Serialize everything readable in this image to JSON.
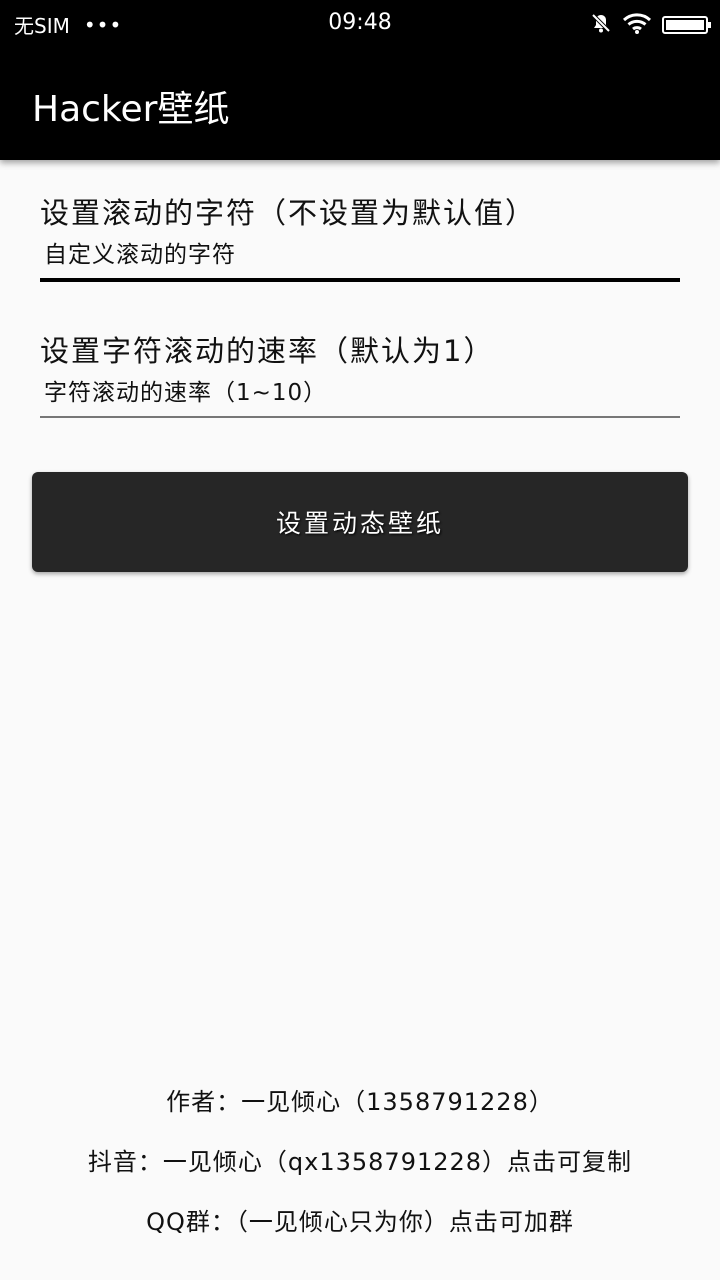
{
  "status_bar": {
    "carrier": "无SIM",
    "dots": "•••",
    "time": "09:48",
    "battery_level": 1.0
  },
  "app_bar": {
    "title": "Hacker壁纸"
  },
  "form": {
    "chars_label": "设置滚动的字符（不设置为默认值）",
    "chars_placeholder": "自定义滚动的字符",
    "rate_label": "设置字符滚动的速率（默认为1）",
    "rate_placeholder": "字符滚动的速率（1~10）",
    "submit_label": "设置动态壁纸"
  },
  "footer": {
    "author": "作者：一见倾心（1358791228）",
    "douyin": "抖音：一见倾心（qx1358791228）点击可复制",
    "qq_group": "QQ群：（一见倾心只为你）点击可加群"
  },
  "colors": {
    "app_bar": "#000000",
    "background": "#fafafa",
    "button": "#262626"
  }
}
